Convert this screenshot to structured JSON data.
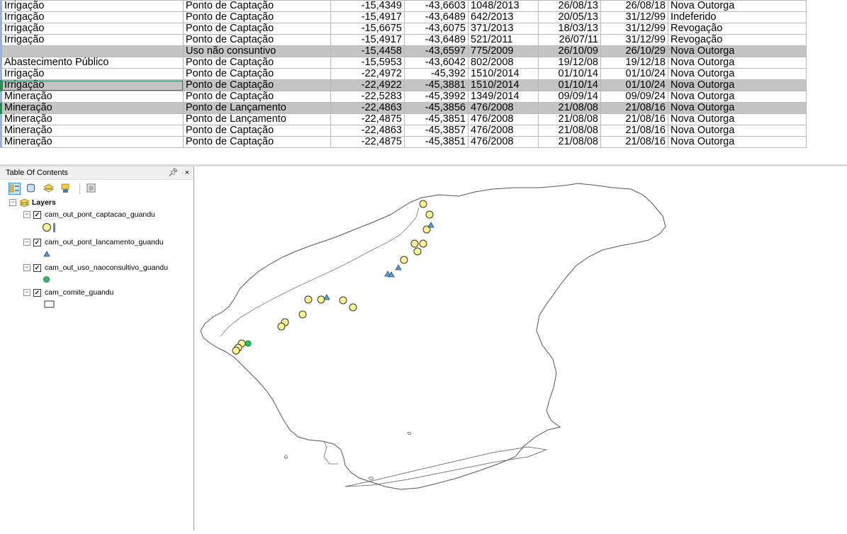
{
  "table": {
    "rows": [
      {
        "uso": "Irrigação",
        "tipo": "Ponto de Captação",
        "lat": "-15,4349",
        "lon": "-43,6603",
        "portaria": "1048/2013",
        "data_inicio": "26/08/13",
        "data_fim": "26/08/18",
        "status": "Nova Outorga",
        "state": ""
      },
      {
        "uso": "Irrigação",
        "tipo": "Ponto de Captação",
        "lat": "-15,4917",
        "lon": "-43,6489",
        "portaria": "642/2013",
        "data_inicio": "20/05/13",
        "data_fim": "31/12/99",
        "status": "Indeferido",
        "state": ""
      },
      {
        "uso": "Irrigação",
        "tipo": "Ponto de Captação",
        "lat": "-15,6675",
        "lon": "-43,6075",
        "portaria": "371/2013",
        "data_inicio": "18/03/13",
        "data_fim": "31/12/99",
        "status": "Revogação",
        "state": ""
      },
      {
        "uso": "Irrigação",
        "tipo": "Ponto de Captação",
        "lat": "-15,4917",
        "lon": "-43,6489",
        "portaria": "521/2011",
        "data_inicio": "26/07/11",
        "data_fim": "31/12/99",
        "status": "Revogação",
        "state": ""
      },
      {
        "uso": "",
        "tipo": "Uso não consuntivo",
        "lat": "-15,4458",
        "lon": "-43,6597",
        "portaria": "775/2009",
        "data_inicio": "26/10/09",
        "data_fim": "26/10/29",
        "status": "Nova Outorga",
        "state": "sel"
      },
      {
        "uso": "Abastecimento Público",
        "tipo": "Ponto de Captação",
        "lat": "-15,5953",
        "lon": "-43,6042",
        "portaria": "802/2008",
        "data_inicio": "19/12/08",
        "data_fim": "19/12/18",
        "status": "Nova Outorga",
        "state": ""
      },
      {
        "uso": "Irrigação",
        "tipo": "Ponto de Captação",
        "lat": "-22,4972",
        "lon": "-45,392",
        "portaria": "1510/2014",
        "data_inicio": "01/10/14",
        "data_fim": "01/10/24",
        "status": "Nova Outorga",
        "state": ""
      },
      {
        "uso": "Irrigação",
        "tipo": "Ponto de Captação",
        "lat": "-22,4922",
        "lon": "-45,3881",
        "portaria": "1510/2014",
        "data_inicio": "01/10/14",
        "data_fim": "01/10/24",
        "status": "Nova Outorga",
        "state": "sel focus"
      },
      {
        "uso": "Mineração",
        "tipo": "Ponto de Captação",
        "lat": "-22,5283",
        "lon": "-45,3992",
        "portaria": "1349/2014",
        "data_inicio": "09/09/14",
        "data_fim": "09/09/24",
        "status": "Nova Outorga",
        "state": ""
      },
      {
        "uso": "Mineração",
        "tipo": "Ponto de Lançamento",
        "lat": "-22,4863",
        "lon": "-45,3856",
        "portaria": "476/2008",
        "data_inicio": "21/08/08",
        "data_fim": "21/08/16",
        "status": "Nova Outorga",
        "state": "sel"
      },
      {
        "uso": "Mineração",
        "tipo": "Ponto de Lançamento",
        "lat": "-22,4875",
        "lon": "-45,3851",
        "portaria": "476/2008",
        "data_inicio": "21/08/08",
        "data_fim": "21/08/16",
        "status": "Nova Outorga",
        "state": ""
      },
      {
        "uso": "Mineração",
        "tipo": "Ponto de Captação",
        "lat": "-22,4863",
        "lon": "-45,3857",
        "portaria": "476/2008",
        "data_inicio": "21/08/08",
        "data_fim": "21/08/16",
        "status": "Nova Outorga",
        "state": ""
      },
      {
        "uso": "Mineração",
        "tipo": "Ponto de Captação",
        "lat": "-22,4875",
        "lon": "-45,3851",
        "portaria": "476/2008",
        "data_inicio": "21/08/08",
        "data_fim": "21/08/16",
        "status": "Nova Outorga",
        "state": ""
      }
    ]
  },
  "toc": {
    "title": "Table Of Contents",
    "pin_glyph": "%A",
    "close_glyph": "×",
    "toolbar": [
      {
        "name": "list-by-drawing-order-icon",
        "active": true
      },
      {
        "name": "list-by-source-icon",
        "active": false
      },
      {
        "name": "list-by-visibility-icon",
        "active": false
      },
      {
        "name": "list-by-selection-icon",
        "active": false
      },
      {
        "name": "options-icon",
        "active": false
      }
    ],
    "root_label": "Layers",
    "layers": [
      {
        "name": "cam_out_pont_captacao_guandu",
        "checked": true,
        "symbol": "yellow-circle"
      },
      {
        "name": "cam_out_pont_lancamento_guandu",
        "checked": true,
        "symbol": "blue-triangle"
      },
      {
        "name": "cam_out_uso_naoconsultivo_guandu",
        "checked": true,
        "symbol": "green-circle"
      },
      {
        "name": "cam_comite_guandu",
        "checked": true,
        "symbol": "hollow-rectangle"
      }
    ]
  },
  "colors": {
    "captacao_fill": "#fff68f",
    "lancamento_fill": "#5b9bd5",
    "naoconsuntivo_fill": "#22c55e",
    "boundary": "#555555",
    "selection": "#c4c4c4"
  }
}
